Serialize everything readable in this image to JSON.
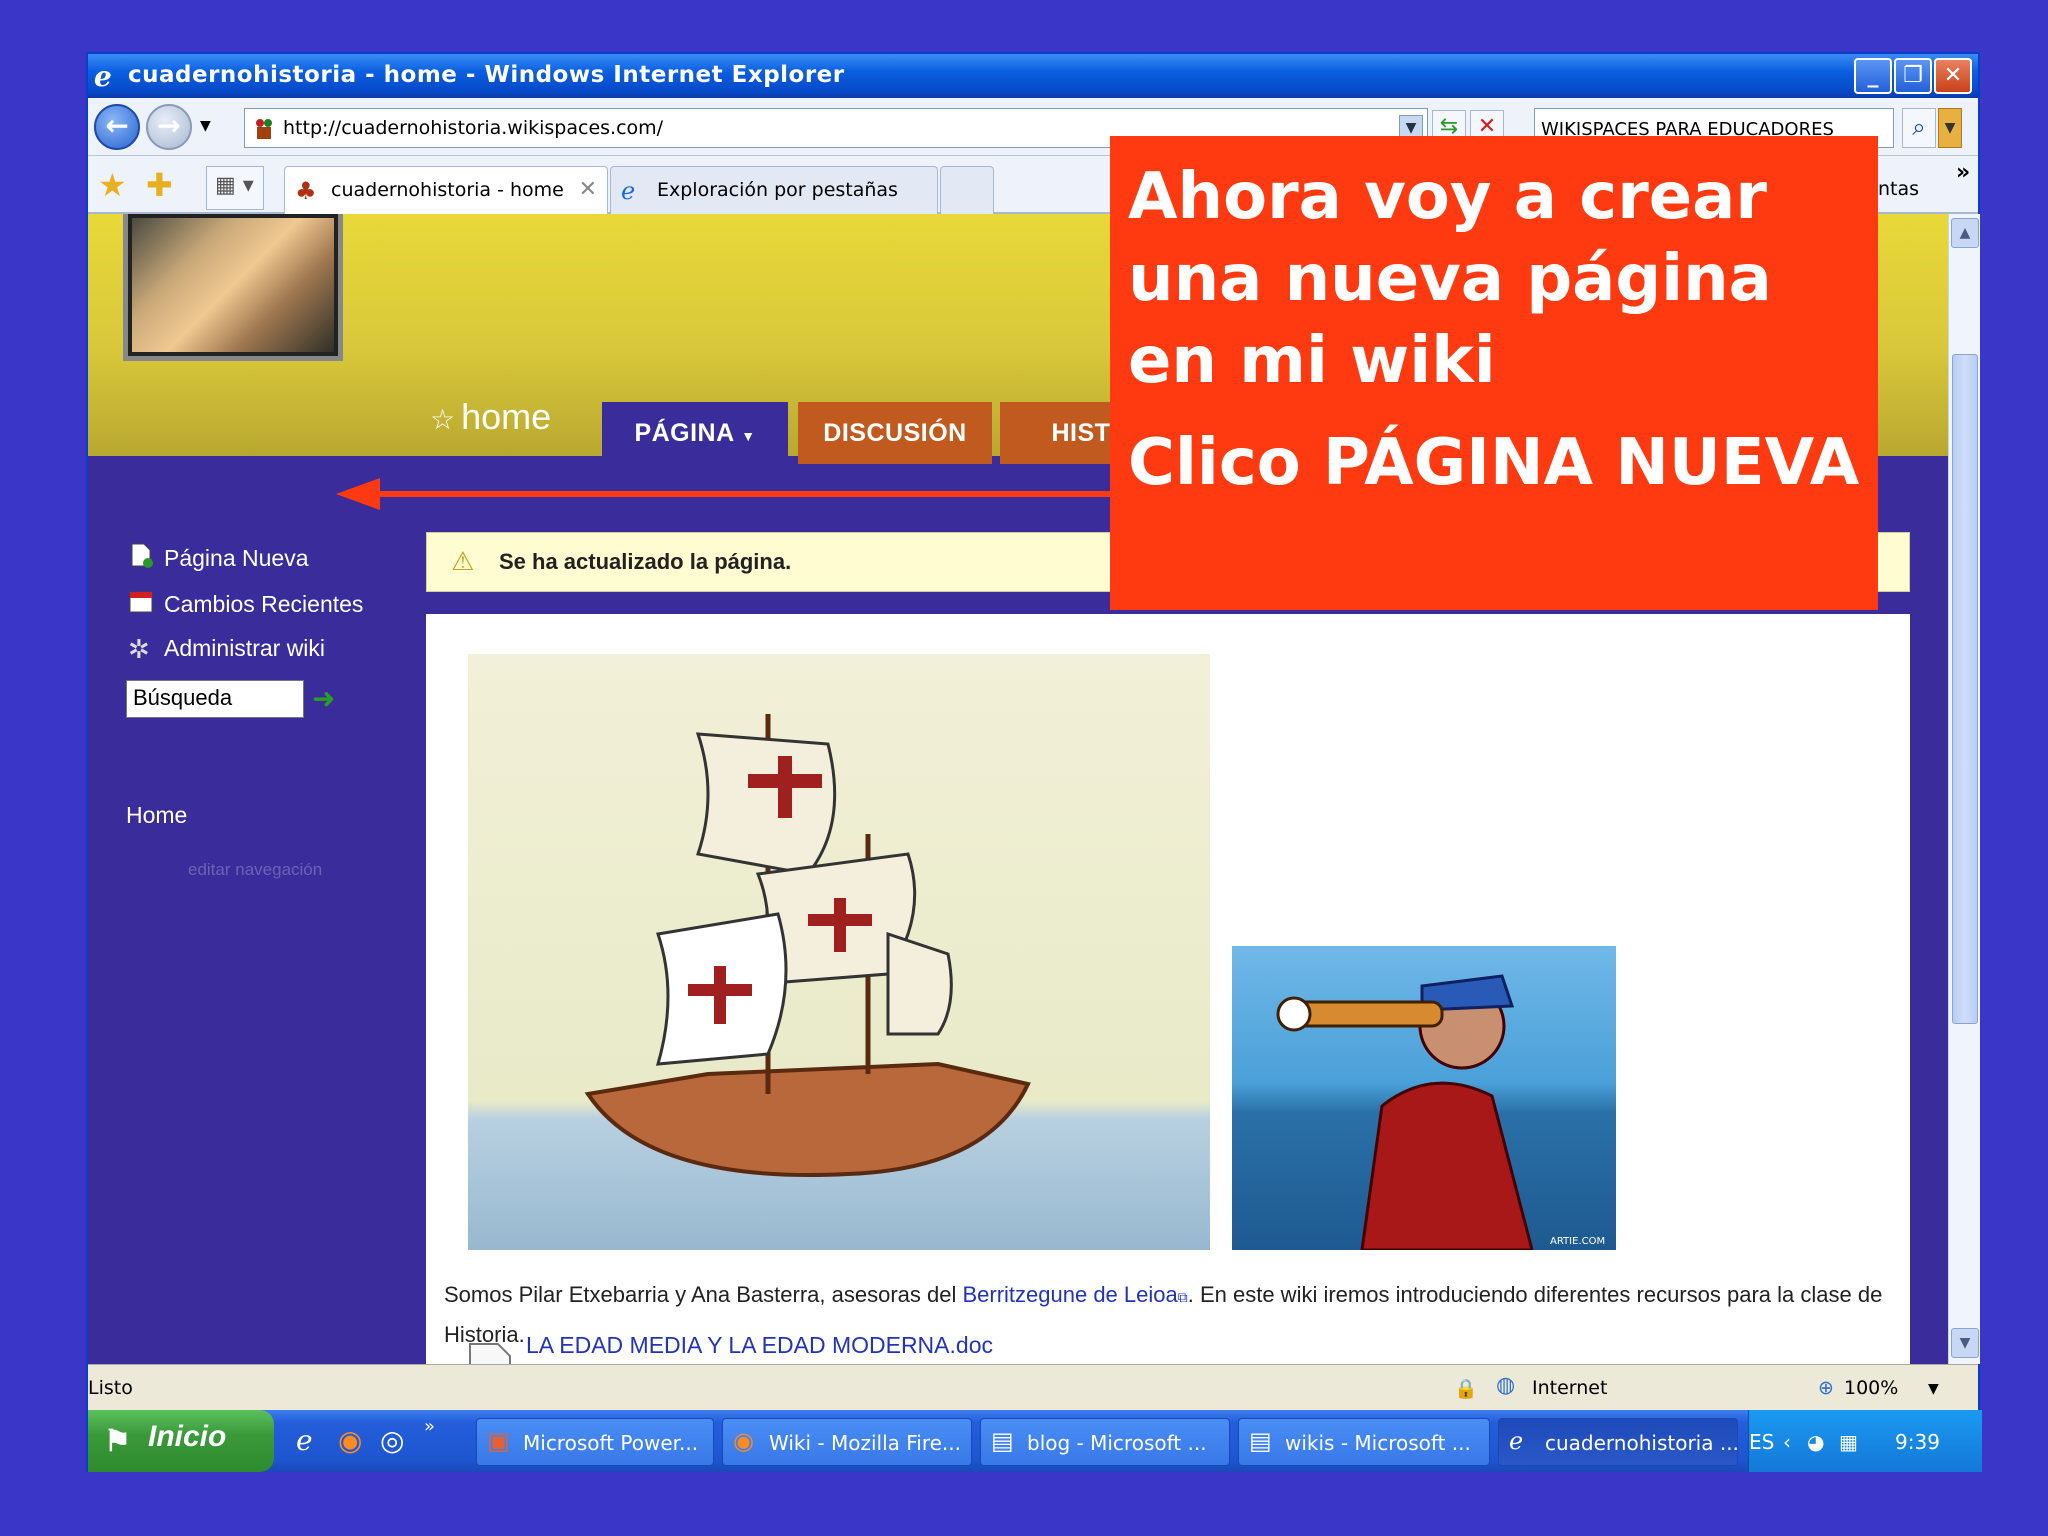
{
  "window": {
    "title": "cuadernohistoria - home - Windows Internet Explorer"
  },
  "address_bar": {
    "url": "http://cuadernohistoria.wikispaces.com/"
  },
  "search": {
    "value": "WIKISPACES PARA EDUCADORES"
  },
  "tabs": [
    {
      "label": "cuadernohistoria - home"
    },
    {
      "label": "Exploración por pestañas"
    }
  ],
  "toolbar": {
    "tools_partial": "ntas",
    "more": "»"
  },
  "site": {
    "page_title": "home",
    "nav_tabs": [
      "PÁGINA",
      "DISCUSIÓN",
      "HISTOR"
    ]
  },
  "sidebar": {
    "items": [
      {
        "label": "Página Nueva",
        "icon": "new-page-icon"
      },
      {
        "label": "Cambios Recientes",
        "icon": "calendar-icon"
      },
      {
        "label": "Administrar wiki",
        "icon": "gear-icon"
      }
    ],
    "search_value": "Búsqueda",
    "home_link": "Home",
    "edit_nav": "editar navegación"
  },
  "notice": {
    "text": "Se ha actualizado la página."
  },
  "content": {
    "caption_pre": "Somos Pilar Etxebarria y Ana Basterra, asesoras del ",
    "caption_link": "Berritzegune de Leioa",
    "caption_post": ". En este wiki iremos introduciendo diferentes recursos para la clase de Historia.",
    "doc_link": "LA EDAD MEDIA Y LA EDAD MODERNA.doc",
    "image_credit": "ARTIE.COM"
  },
  "statusbar": {
    "left": "Listo",
    "zone": "Internet",
    "zoom": "100%"
  },
  "taskbar": {
    "start": "Inicio",
    "buttons": [
      "Microsoft Power...",
      "Wiki - Mozilla Fire...",
      "blog - Microsoft ...",
      "wikis - Microsoft ...",
      "cuadernohistoria ..."
    ],
    "lang": "ES",
    "time": "9:39"
  },
  "callout": {
    "line1": "Ahora voy a crear una nueva página en mi wiki",
    "line2": "Clico PÁGINA NUEVA"
  },
  "colors": {
    "callout": "#ff3a10",
    "header": "#d9c83a",
    "sidebar": "#3a2c9a",
    "tab_orange": "#c15a1e"
  }
}
